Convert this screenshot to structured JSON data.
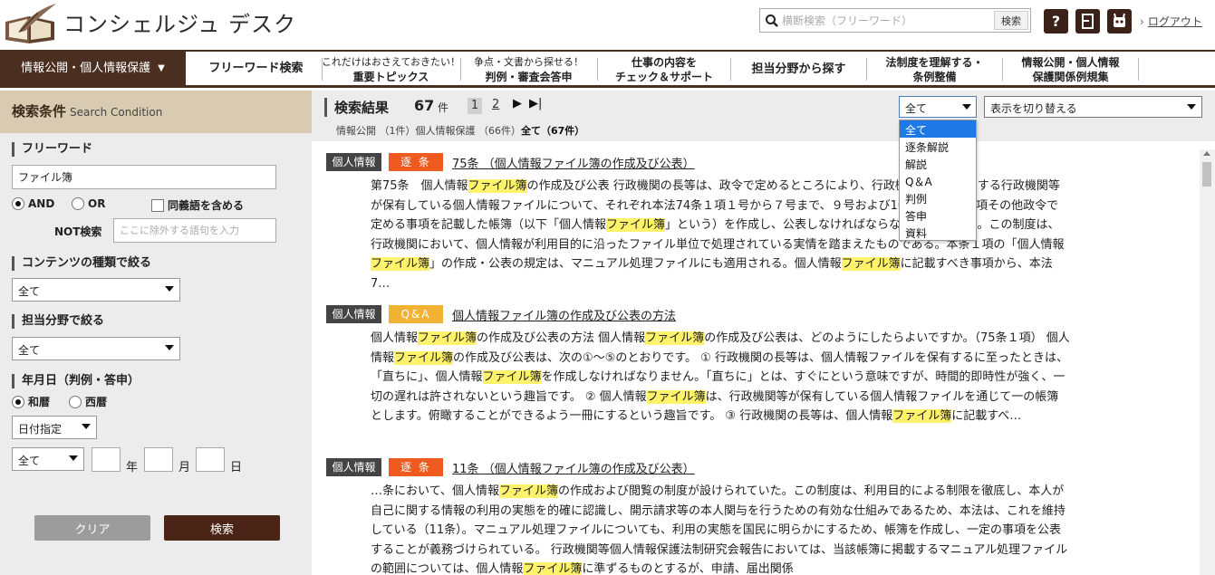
{
  "header": {
    "title": "コンシェルジュ デスク",
    "search_placeholder": "横断検索（フリーワード）",
    "search_button": "検索",
    "logout": "ログアウト"
  },
  "nav": {
    "active": "情報公開・個人情報保護",
    "items": [
      {
        "line1": "フリーワード検索",
        "line2": ""
      },
      {
        "line1": "これだけはおさえておきたい！",
        "line2": "重要トピックス"
      },
      {
        "line1": "争点・文書から探せる！",
        "line2": "判例・審査会答申"
      },
      {
        "line1": "仕事の内容を",
        "line2": "チェック＆サポート"
      },
      {
        "line1": "担当分野から探す",
        "line2": ""
      },
      {
        "line1": "法制度を理解する・",
        "line2": "条例整備"
      },
      {
        "line1": "情報公開・個人情報",
        "line2": "保護関係例規集"
      }
    ]
  },
  "sidebar": {
    "heading": "検索条件",
    "heading_en": "Search Condition",
    "freeword_label": "フリーワード",
    "freeword_value": "ファイル簿",
    "and_label": "AND",
    "or_label": "OR",
    "synonym_label": "同義語を含める",
    "not_label": "NOT検索",
    "not_placeholder": "ここに除外する語句を入力",
    "contents_label": "コンテンツの種類で絞る",
    "contents_value": "全て",
    "field_label": "担当分野で絞る",
    "field_value": "全て",
    "date_label": "年月日（判例・答申）",
    "wareki_label": "和暦",
    "seireki_label": "西暦",
    "date_mode": "日付指定",
    "era_value": "全て",
    "year_unit": "年",
    "month_unit": "月",
    "day_unit": "日",
    "clear_button": "クリア",
    "search_button": "検索"
  },
  "results_head": {
    "title": "検索結果",
    "count": "67",
    "unit": "件",
    "page1": "1",
    "page2": "2",
    "facet_text": "情報公開 （1件）個人情報保護 （66件）",
    "facet_all": "全て（67件）",
    "type_value": "全て",
    "view_value": "表示を切り替える",
    "type_options": [
      "全て",
      "逐条解説",
      "解説",
      "Q＆A",
      "判例",
      "答申",
      "資料"
    ]
  },
  "results": [
    {
      "category": "個人情報",
      "kind": "逐 条",
      "kind_color": "#ef5a1f",
      "title": "75条 （個人情報ファイル簿の作成及び公表）",
      "snippet_parts": [
        {
          "t": "第75条　個人情報",
          "h": false
        },
        {
          "t": "ファイル簿",
          "h": true
        },
        {
          "t": "の作成及び公表 行政機関の長等は、政令で定めるところにより、行政機関の長等の属する行政機関等が保有している個人情報ファイルについて、それぞれ本法74条１項１号から７号まで、９号および10号に掲げる事項その他政令で定める事項を記載した帳簿（以下「個人情報",
          "h": false
        },
        {
          "t": "ファイル簿",
          "h": true
        },
        {
          "t": "」という）を作成し、公表しなければならない（本条１項）。この制度は、行政機関において、個人情報が利用目的に沿ったファイル単位で処理されている実情を踏まえたものである。本条１項の「個人情報",
          "h": false
        },
        {
          "t": "ファイル簿",
          "h": true
        },
        {
          "t": "」の作成・公表の規定は、マニュアル処理ファイルにも適用される。個人情報",
          "h": false
        },
        {
          "t": "ファイル簿",
          "h": true
        },
        {
          "t": "に記載すべき事項から、本法7…",
          "h": false
        }
      ]
    },
    {
      "category": "個人情報",
      "kind": "Q&A",
      "kind_color": "#f2b233",
      "title": "個人情報ファイル簿の作成及び公表の方法",
      "snippet_parts": [
        {
          "t": "個人情報",
          "h": false
        },
        {
          "t": "ファイル簿",
          "h": true
        },
        {
          "t": "の作成及び公表の方法 個人情報",
          "h": false
        },
        {
          "t": "ファイル簿",
          "h": true
        },
        {
          "t": "の作成及び公表は、どのようにしたらよいですか。（75条１項） 個人情報",
          "h": false
        },
        {
          "t": "ファイル簿",
          "h": true
        },
        {
          "t": "の作成及び公表は、次の①～⑤のとおりです。 ① 行政機関の長等は、個人情報ファイルを保有するに至ったときは、「直ちに」、個人情報",
          "h": false
        },
        {
          "t": "ファイル簿",
          "h": true
        },
        {
          "t": "を作成しなければなりません。「直ちに」とは、すぐにという意味ですが、時間的即時性が強く、一切の遅れは許されないという趣旨です。 ② 個人情報",
          "h": false
        },
        {
          "t": "ファイル簿",
          "h": true
        },
        {
          "t": "は、行政機関等が保有している個人情報ファイルを通じて一の帳簿とします。俯瞰することができるよう一冊にするという趣旨です。 ③ 行政機関の長等は、個人情報",
          "h": false
        },
        {
          "t": "ファイル簿",
          "h": true
        },
        {
          "t": "に記載すべ…",
          "h": false
        }
      ]
    },
    {
      "category": "個人情報",
      "kind": "逐 条",
      "kind_color": "#ef5a1f",
      "title": "11条 （個人情報ファイル簿の作成及び公表）",
      "snippet_parts": [
        {
          "t": "…条において、個人情報",
          "h": false
        },
        {
          "t": "ファイル簿",
          "h": true
        },
        {
          "t": "の作成および閲覧の制度が設けられていた。この制度は、利用目的による制限を徹底し、本人が自己に関する情報の利用の実態を的確に認識し、開示請求等の本人関与を行うための有効な仕組みであるため、本法は、これを維持している（11条）。マニュアル処理ファイルについても、利用の実態を国民に明らかにするため、帳簿を作成し、一定の事項を公表することが義務づけられている。 行政機関等個人情報保護法制研究会報告においては、当該帳簿に掲載するマニュアル処理ファイルの範囲については、個人情報",
          "h": false
        },
        {
          "t": "ファイル簿",
          "h": true
        },
        {
          "t": "に準ずるものとするが、申請、届出関係",
          "h": false
        }
      ]
    }
  ]
}
